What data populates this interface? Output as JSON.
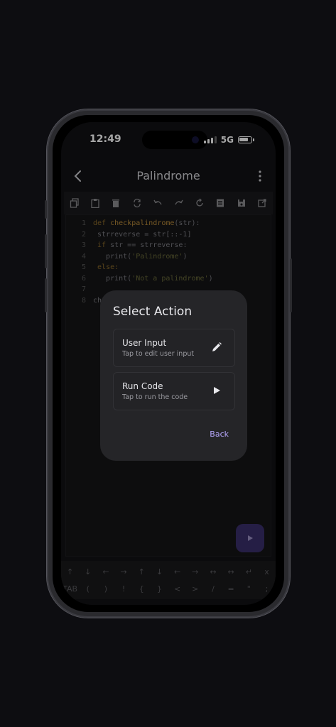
{
  "status": {
    "time": "12:49",
    "network": "5G"
  },
  "appbar": {
    "title": "Palindrome"
  },
  "toolbar": {
    "icons": [
      "copy-icon",
      "paste-icon",
      "delete-icon",
      "replace-icon",
      "undo-icon",
      "redo-icon",
      "refresh-icon",
      "document-icon",
      "save-icon",
      "share-icon"
    ]
  },
  "editor": {
    "lines": [
      {
        "num": "1",
        "parts": [
          {
            "t": "def ",
            "c": "kw"
          },
          {
            "t": "checkpalindrome",
            "c": "fn"
          },
          {
            "t": "(str):",
            "c": "tx"
          }
        ]
      },
      {
        "num": "2",
        "parts": [
          {
            "t": " strreverse = str[::-1]",
            "c": "tx"
          }
        ]
      },
      {
        "num": "3",
        "parts": [
          {
            "t": " ",
            "c": "tx"
          },
          {
            "t": "if",
            "c": "kw"
          },
          {
            "t": " str == strreverse:",
            "c": "tx"
          }
        ]
      },
      {
        "num": "4",
        "parts": [
          {
            "t": "   print(",
            "c": "tx"
          },
          {
            "t": "'Palindrome'",
            "c": "st"
          },
          {
            "t": ")",
            "c": "tx"
          }
        ]
      },
      {
        "num": "5",
        "parts": [
          {
            "t": " ",
            "c": "tx"
          },
          {
            "t": "else:",
            "c": "kw"
          }
        ]
      },
      {
        "num": "6",
        "parts": [
          {
            "t": "   print(",
            "c": "tx"
          },
          {
            "t": "'Not a palindrome'",
            "c": "st"
          },
          {
            "t": ")",
            "c": "tx"
          }
        ]
      },
      {
        "num": "7",
        "parts": []
      },
      {
        "num": "8",
        "parts": [
          {
            "t": "che",
            "c": "tx"
          }
        ]
      }
    ]
  },
  "keyboard": {
    "row1": [
      "↑",
      "↓",
      "←",
      "→",
      "↑",
      "↓",
      "←",
      "→",
      "↔",
      "↔",
      "↵",
      "x"
    ],
    "row2": [
      "TAB",
      "(",
      ")",
      "!",
      "{",
      "}",
      "<",
      ">",
      "/",
      "=",
      "\"",
      ";"
    ]
  },
  "dialog": {
    "title": "Select Action",
    "options": [
      {
        "title": "User Input",
        "subtitle": "Tap to edit user input",
        "icon": "pencil-icon"
      },
      {
        "title": "Run Code",
        "subtitle": "Tap to run the code",
        "icon": "play-icon"
      }
    ],
    "back_label": "Back"
  },
  "colors": {
    "accent": "#b9a9ff",
    "fab": "#3a2f6a",
    "dialog_bg": "#252528"
  }
}
